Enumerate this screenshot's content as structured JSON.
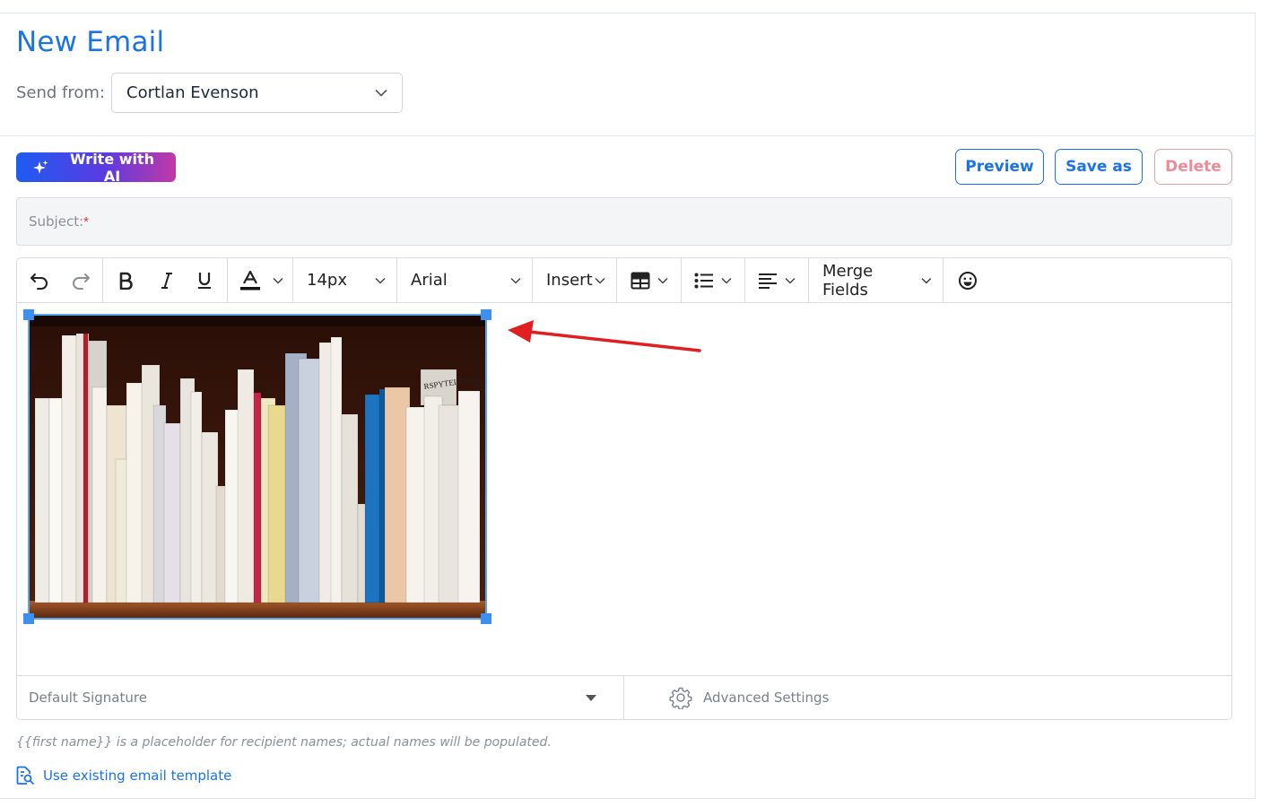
{
  "header": {
    "title": "New Email",
    "send_from_label": "Send from:",
    "send_from_value": "Cortlan Evenson"
  },
  "actions": {
    "write_ai_label": "Write with AI",
    "preview_label": "Preview",
    "save_as_label": "Save as",
    "delete_label": "Delete"
  },
  "subject": {
    "label": "Subject:",
    "required_mark": "*"
  },
  "toolbar": {
    "font_size": "14px",
    "font_family": "Arial",
    "insert_label": "Insert",
    "merge_fields_label": "Merge Fields",
    "icons": [
      "undo-icon",
      "redo-icon",
      "bold-icon",
      "italic-icon",
      "underline-icon",
      "text-color-icon",
      "table-icon",
      "bulleted-list-icon",
      "align-icon",
      "emoji-icon"
    ]
  },
  "editor_body": {
    "image_subject": "bookshelf photo",
    "annotation": "red arrow pointing at image"
  },
  "footer": {
    "signature_value": "Default Signature",
    "advanced_settings_label": "Advanced Settings"
  },
  "note": "{{first name}} is a placeholder for recipient names; actual names will be populated.",
  "template_link_label": "Use existing email template",
  "colors": {
    "accent": "#1a73e8",
    "delete": "#ec8c99",
    "ai_gradient": [
      "#1e5cf2",
      "#c03aa6"
    ],
    "arrow": "#e02020",
    "selection": "#3d8ff0"
  }
}
